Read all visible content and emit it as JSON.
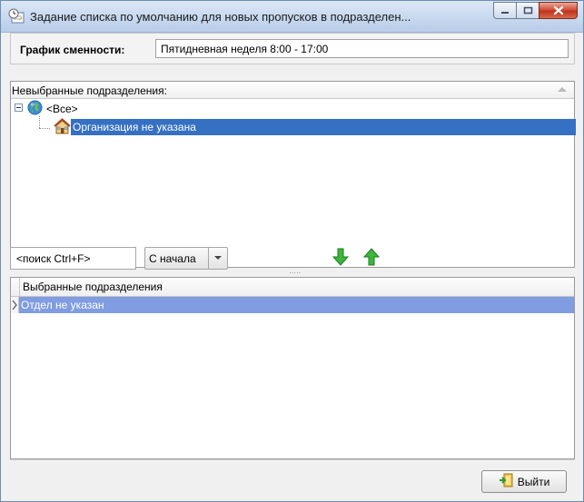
{
  "window": {
    "title": "Задание списка по умолчанию для новых пропусков в подразделен..."
  },
  "schedule": {
    "label": "График сменности:",
    "value": "Пятидневная неделя 8:00 - 17:00"
  },
  "unselected": {
    "header": "Невыбранные подразделения:",
    "root_label": "<Все>",
    "items": [
      {
        "label": "Организация не указана",
        "selected": true
      }
    ]
  },
  "search": {
    "placeholder": "<поиск Ctrl+F>",
    "mode": "С начала"
  },
  "selected": {
    "header": "Выбранные подразделения",
    "rows": [
      {
        "label": "Отдел не указан"
      }
    ]
  },
  "footer": {
    "exit_label": "Выйти"
  },
  "colors": {
    "selection": "#3570c3",
    "grid_selection": "#7f9de0",
    "arrow_green": "#2ea52e"
  }
}
